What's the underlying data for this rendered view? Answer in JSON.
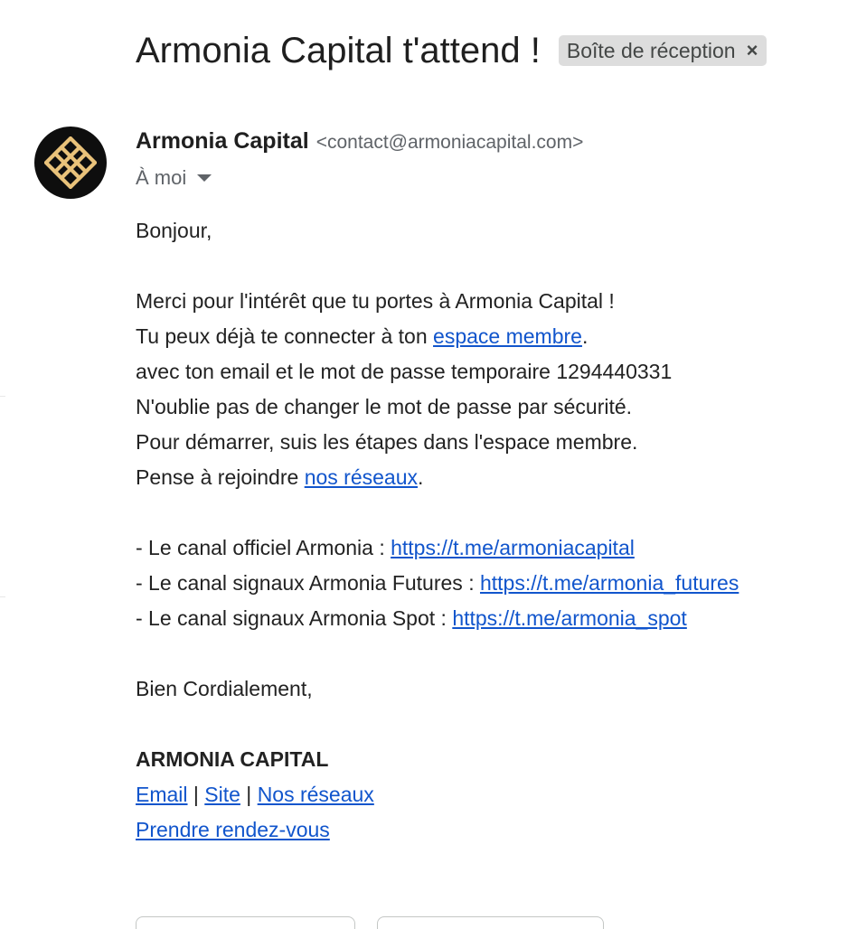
{
  "header": {
    "subject": "Armonia Capital t'attend !",
    "label": "Boîte de réception",
    "label_close": "×"
  },
  "sender": {
    "name": "Armonia Capital",
    "email": "<contact@armoniacapital.com>",
    "to": "À moi"
  },
  "body": {
    "greeting": "Bonjour,",
    "l1": "Merci pour l'intérêt que tu portes à Armonia Capital !",
    "l2_prefix": "Tu peux déjà te connecter à ton ",
    "l2_link": "espace membre",
    "l2_suffix": ".",
    "l3": "avec ton email et le mot de passe temporaire 1294440331",
    "l4": "N'oublie pas de changer le mot de passe par sécurité.",
    "l5": "Pour démarrer, suis les étapes dans l'espace membre.",
    "l6_prefix": "Pense à rejoindre ",
    "l6_link": "nos réseaux",
    "l6_suffix": ".",
    "c1_prefix": "- Le canal officiel Armonia : ",
    "c1_link": "https://t.me/armoniacapital",
    "c2_prefix": "- Le canal signaux Armonia Futures : ",
    "c2_link": "https://t.me/armonia_futures",
    "c3_prefix": "- Le canal signaux Armonia Spot : ",
    "c3_link": "https://t.me/armonia_spot",
    "closing": "Bien Cordialement,",
    "signature": "ARMONIA CAPITAL",
    "sig_email": "Email",
    "sep": " | ",
    "sig_site": "Site",
    "sig_networks": "Nos réseaux",
    "sig_rdv": "Prendre rendez-vous"
  },
  "colors": {
    "link": "#1155cc",
    "chip_bg": "#dddddd",
    "avatar_bg": "#0e0e0e",
    "logo_gold": "#e9c27a"
  },
  "icons": {
    "avatar_logo": "armonia-knot-logo",
    "dropdown": "caret-down-icon"
  }
}
